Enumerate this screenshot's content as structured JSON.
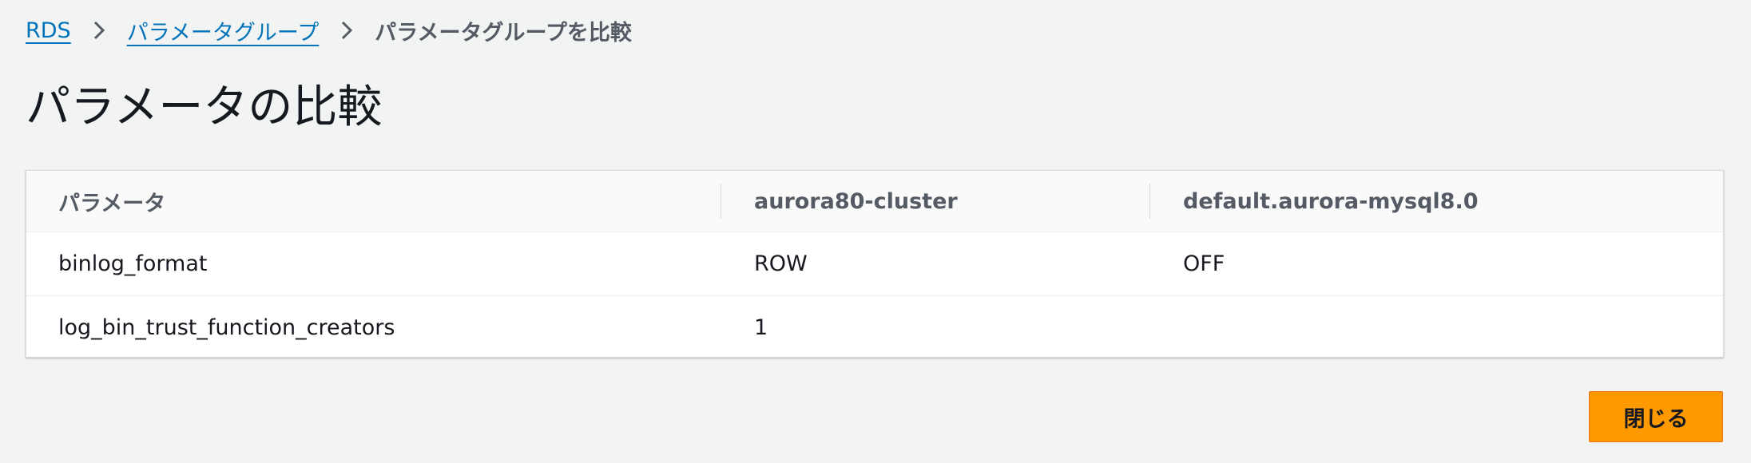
{
  "breadcrumb": {
    "items": [
      {
        "label": "RDS"
      },
      {
        "label": "パラメータグループ"
      }
    ],
    "current": "パラメータグループを比較"
  },
  "page": {
    "title": "パラメータの比較"
  },
  "table": {
    "headers": [
      "パラメータ",
      "aurora80-cluster",
      "default.aurora-mysql8.0"
    ],
    "rows": [
      [
        "binlog_format",
        "ROW",
        "OFF"
      ],
      [
        "log_bin_trust_function_creators",
        "1",
        ""
      ]
    ]
  },
  "actions": {
    "close_label": "閉じる"
  },
  "colors": {
    "link": "#0073bb",
    "primary_button": "#ff9900",
    "background": "#f2f3f3"
  },
  "icons": {
    "breadcrumb_separator": "chevron-right-icon"
  }
}
